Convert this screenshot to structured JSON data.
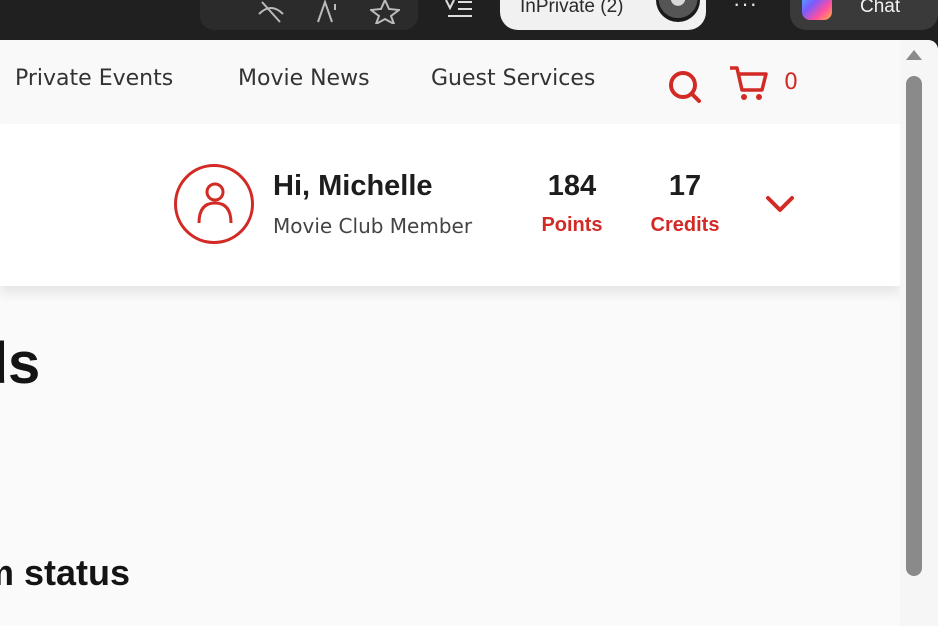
{
  "browser": {
    "inprivate_label": "InPrivate (2)",
    "more_label": "···",
    "chat_label": "Chat",
    "icons": [
      "hide-icon",
      "read-aloud-icon",
      "favorite-star-icon",
      "favorites-list-icon",
      "profile-avatar-icon",
      "copilot-icon"
    ]
  },
  "nav": {
    "links": [
      "Private Events",
      "Movie News",
      "Guest Services"
    ],
    "cart_count": "0"
  },
  "member": {
    "greeting": "Hi, Michelle",
    "tier": "Movie Club Member",
    "points_value": "184",
    "points_label": "Points",
    "credits_value": "17",
    "credits_label": "Credits"
  },
  "content": {
    "heading_partial": "rds",
    "subheading_partial": "num status"
  },
  "colors": {
    "accent": "#d22b26",
    "text": "#1d1d1d",
    "chrome_bg": "#202020",
    "page_bg": "#fafafa"
  }
}
